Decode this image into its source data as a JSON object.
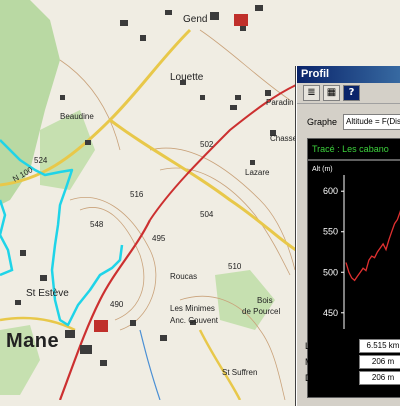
{
  "map": {
    "places": {
      "gend": "Gend",
      "louette": "Louette",
      "beaudine": "Beaudine",
      "paradin": "Paradin",
      "chasseur": "Chasseur",
      "lazare": "Lazare",
      "sevre": "St Estève",
      "roucas": "Roucas",
      "minimes": "Les Minimes",
      "couvent": "Anc. Couvent",
      "bois": "Bois",
      "pourcel": "de Pourcel",
      "suffren": "St Suffren",
      "mane": "Mane",
      "rn": "N 100"
    },
    "elevations": [
      "524",
      "495",
      "516",
      "504",
      "490",
      "510",
      "548",
      "502"
    ]
  },
  "window": {
    "title": "Profil",
    "toolbar": [
      "list-icon",
      "table-icon",
      "help-icon"
    ],
    "graphe_label": "Graphe",
    "graphe_value": "Altitude = F(Dista",
    "trace_text": "Tracé : Les cabano",
    "stats": [
      {
        "label": "Longueur",
        "value": "6.515 km"
      },
      {
        "label": "Montée",
        "value": "206 m"
      },
      {
        "label": "Descente",
        "value": "206 m"
      }
    ]
  },
  "chart_data": {
    "type": "line",
    "ylabel": "Alt (m)",
    "ylim": [
      430,
      620
    ],
    "yticks": [
      450,
      500,
      550,
      600
    ],
    "series": [
      {
        "color": "#e03030",
        "values": [
          512,
          500,
          493,
          490,
          495,
          500,
          505,
          502,
          515,
          520,
          518,
          525,
          530,
          535,
          528,
          540,
          550,
          560,
          565,
          575,
          590,
          600
        ]
      }
    ]
  }
}
